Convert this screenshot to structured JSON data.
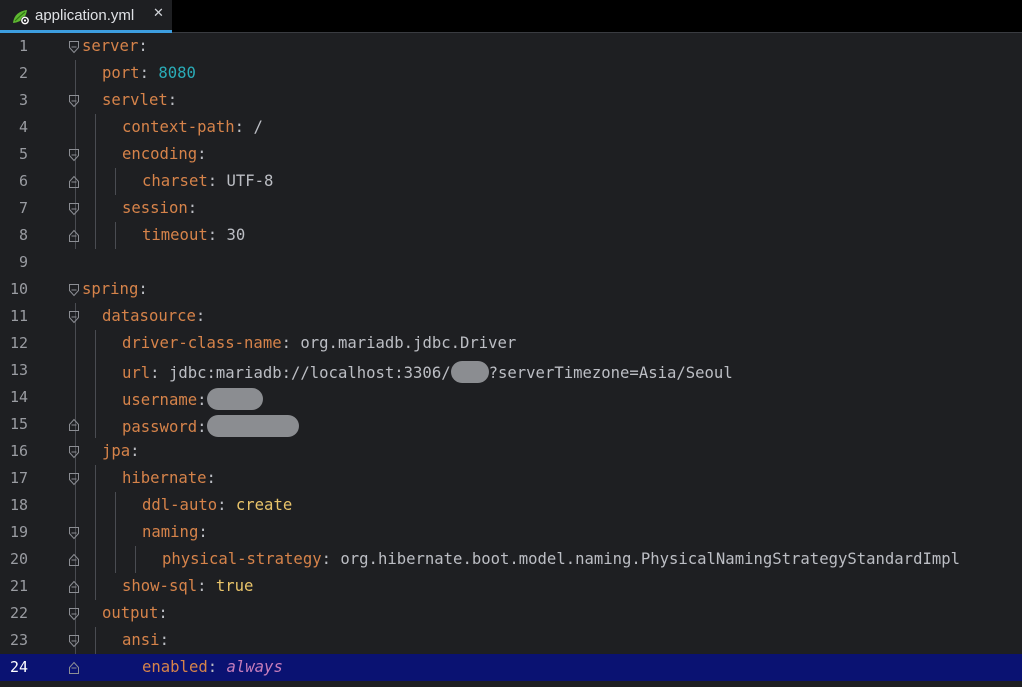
{
  "tab": {
    "file_name": "application.yml",
    "close_glyph": "✕",
    "icon": "yaml-file-icon"
  },
  "colors": {
    "background": "#1e1f22",
    "key": "#d6834a",
    "number": "#2aacb8",
    "keyword": "#e9c46a",
    "enum": "#c77dbb",
    "current_line": "#0a1272",
    "tab_underline": "#3d9ee0"
  },
  "editor": {
    "current_line": 24,
    "lines": [
      {
        "n": "1",
        "indent": 0,
        "key": "server",
        "colon": ":",
        "fold": "start"
      },
      {
        "n": "2",
        "indent": 1,
        "key": "port",
        "colon": ": ",
        "value": "8080",
        "vclass": "num"
      },
      {
        "n": "3",
        "indent": 1,
        "key": "servlet",
        "colon": ":",
        "fold": "start"
      },
      {
        "n": "4",
        "indent": 2,
        "key": "context-path",
        "colon": ": ",
        "value": "/"
      },
      {
        "n": "5",
        "indent": 2,
        "key": "encoding",
        "colon": ":",
        "fold": "start"
      },
      {
        "n": "6",
        "indent": 3,
        "key": "charset",
        "colon": ": ",
        "value": "UTF-8",
        "fold": "end"
      },
      {
        "n": "7",
        "indent": 2,
        "key": "session",
        "colon": ":",
        "fold": "start"
      },
      {
        "n": "8",
        "indent": 3,
        "key": "timeout",
        "colon": ": ",
        "value": "30",
        "fold": "end"
      },
      {
        "n": "9",
        "indent": 0
      },
      {
        "n": "10",
        "indent": 0,
        "key": "spring",
        "colon": ":",
        "fold": "start"
      },
      {
        "n": "11",
        "indent": 1,
        "key": "datasource",
        "colon": ":",
        "fold": "start"
      },
      {
        "n": "12",
        "indent": 2,
        "key": "driver-class-name",
        "colon": ": ",
        "value": "org.mariadb.jdbc.Driver"
      },
      {
        "n": "13",
        "indent": 2,
        "key": "url",
        "colon": ": ",
        "value": "jdbc:mariadb://localhost:3306/",
        "redact": "short",
        "value2": "?serverTimezone=Asia/Seoul"
      },
      {
        "n": "14",
        "indent": 2,
        "key": "username",
        "colon": ":",
        "redact": "medium"
      },
      {
        "n": "15",
        "indent": 2,
        "key": "password",
        "colon": ":",
        "redact": "long",
        "fold": "end"
      },
      {
        "n": "16",
        "indent": 1,
        "key": "jpa",
        "colon": ":",
        "fold": "start"
      },
      {
        "n": "17",
        "indent": 2,
        "key": "hibernate",
        "colon": ":",
        "fold": "start"
      },
      {
        "n": "18",
        "indent": 3,
        "key": "ddl-auto",
        "colon": ": ",
        "value": "create",
        "vclass": "y"
      },
      {
        "n": "19",
        "indent": 3,
        "key": "naming",
        "colon": ":",
        "fold": "start"
      },
      {
        "n": "20",
        "indent": 4,
        "key": "physical-strategy",
        "colon": ": ",
        "value": "org.hibernate.boot.model.naming.PhysicalNamingStrategyStandardImpl",
        "fold": "end"
      },
      {
        "n": "21",
        "indent": 2,
        "key": "show-sql",
        "colon": ": ",
        "value": "true",
        "vclass": "y",
        "fold": "end"
      },
      {
        "n": "22",
        "indent": 1,
        "key": "output",
        "colon": ":",
        "fold": "start"
      },
      {
        "n": "23",
        "indent": 2,
        "key": "ansi",
        "colon": ":",
        "fold": "start"
      },
      {
        "n": "24",
        "indent": 3,
        "key": "enabled",
        "colon": ": ",
        "value": "always",
        "vclass": "it",
        "fold": "end"
      }
    ]
  }
}
